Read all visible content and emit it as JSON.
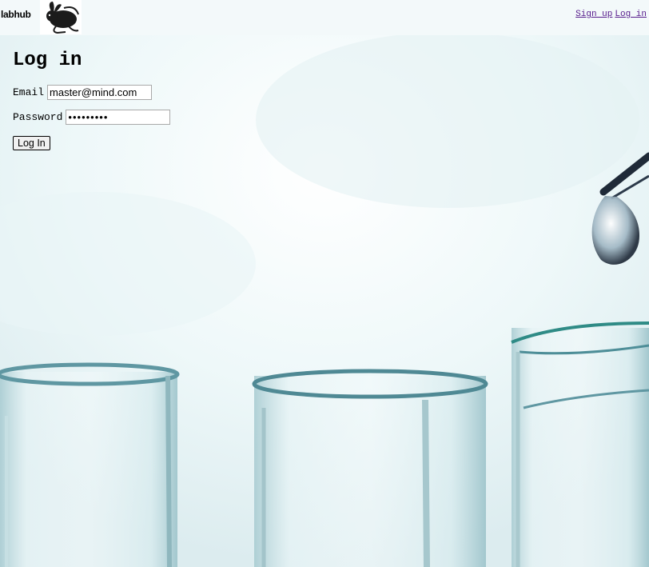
{
  "header": {
    "brand": "labhub",
    "logo_icon": "rabbit-logo-icon",
    "nav": {
      "signup_label": "Sign up",
      "login_label": "Log in"
    }
  },
  "login_form": {
    "title": "Log in",
    "email_label": "Email",
    "email_value": "master@mind.com",
    "password_label": "Password",
    "password_value": "•••••••••",
    "submit_label": "Log In"
  },
  "background": {
    "subject": "lab-test-tubes-and-pipette-image"
  },
  "colors": {
    "header_bg": "#f3f9fa",
    "link": "#551a8b",
    "glass_tint": "#7fb1bb"
  }
}
